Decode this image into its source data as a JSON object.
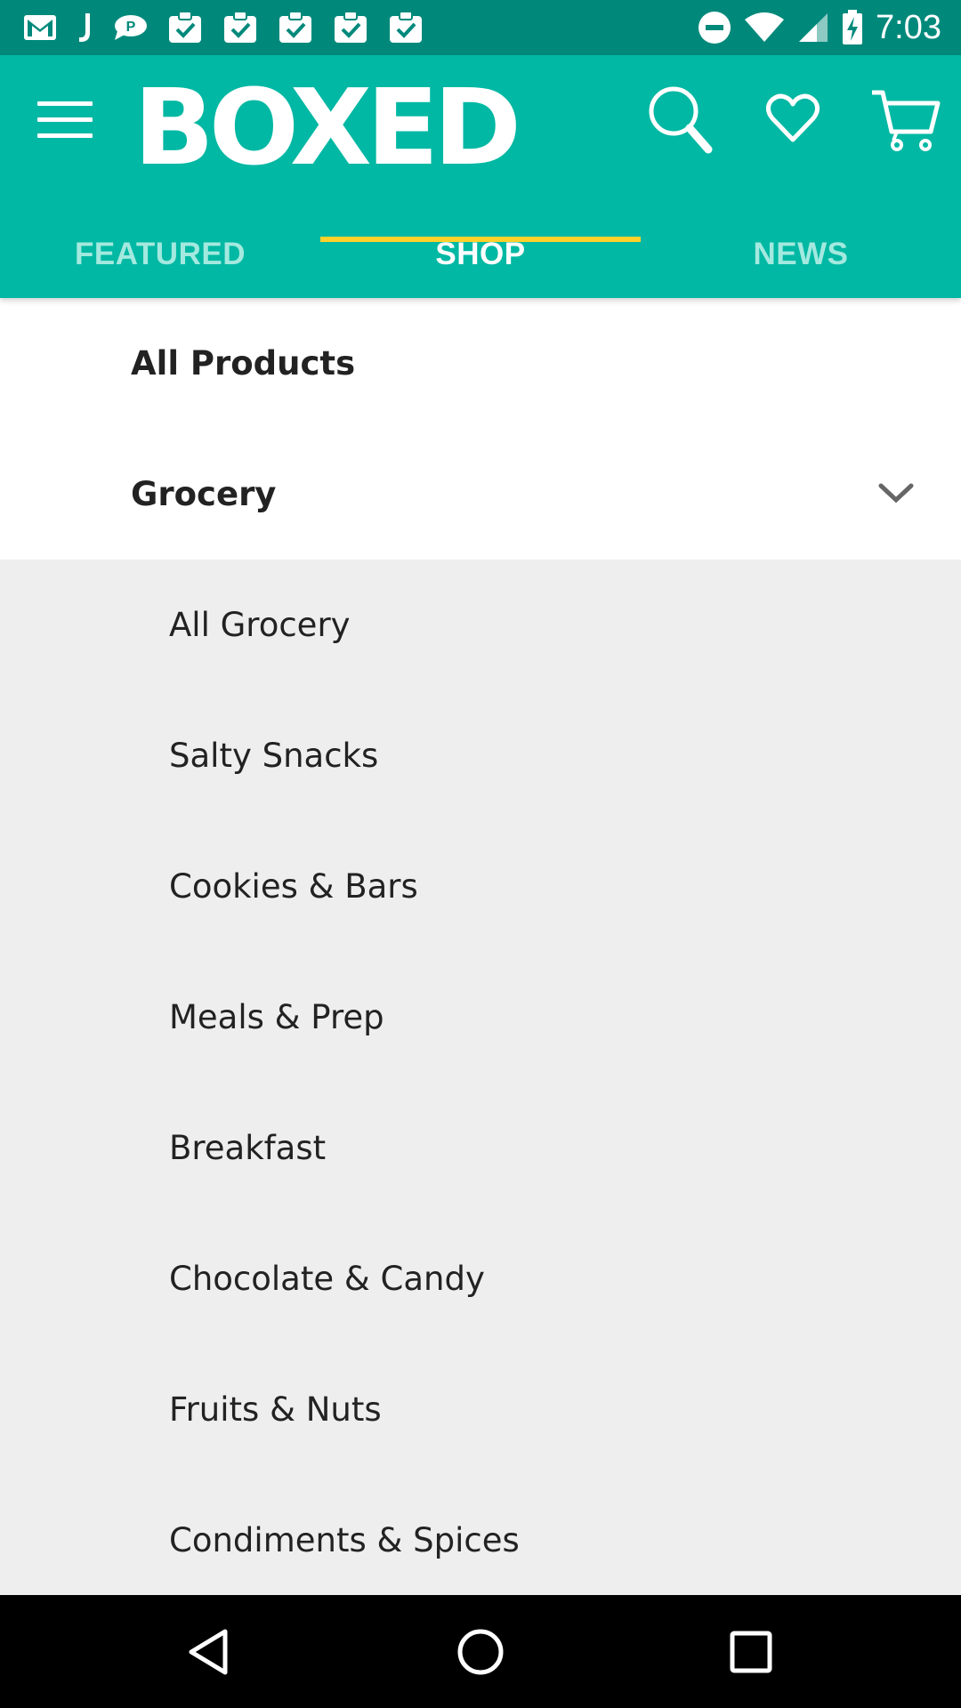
{
  "status_bar": {
    "time": "7:03",
    "notification_icons": [
      "gmail-icon",
      "j-app-icon",
      "chat-bubble-icon",
      "clipboard-check-icon",
      "clipboard-check-icon",
      "clipboard-check-icon",
      "clipboard-check-icon",
      "clipboard-check-icon"
    ],
    "system_icons": [
      "do-not-disturb-icon",
      "wifi-icon",
      "cell-signal-icon",
      "battery-charging-icon"
    ]
  },
  "app_bar": {
    "logo_text": "BOXED",
    "colors": {
      "primary": "#00b8a3",
      "status": "#00897b",
      "indicator": "#ffd12a"
    },
    "actions": [
      "search-icon",
      "heart-icon",
      "cart-icon"
    ]
  },
  "tabs": [
    {
      "label": "FEATURED",
      "active": false
    },
    {
      "label": "SHOP",
      "active": true
    },
    {
      "label": "NEWS",
      "active": false
    }
  ],
  "categories": {
    "all_products": "All Products",
    "grocery": {
      "label": "Grocery",
      "expanded": true
    },
    "grocery_items": [
      "All Grocery",
      "Salty Snacks",
      "Cookies & Bars",
      "Meals & Prep",
      "Breakfast",
      "Chocolate & Candy",
      "Fruits & Nuts",
      "Condiments & Spices"
    ]
  },
  "nav_bar": [
    "back-icon",
    "home-icon",
    "recent-apps-icon"
  ]
}
